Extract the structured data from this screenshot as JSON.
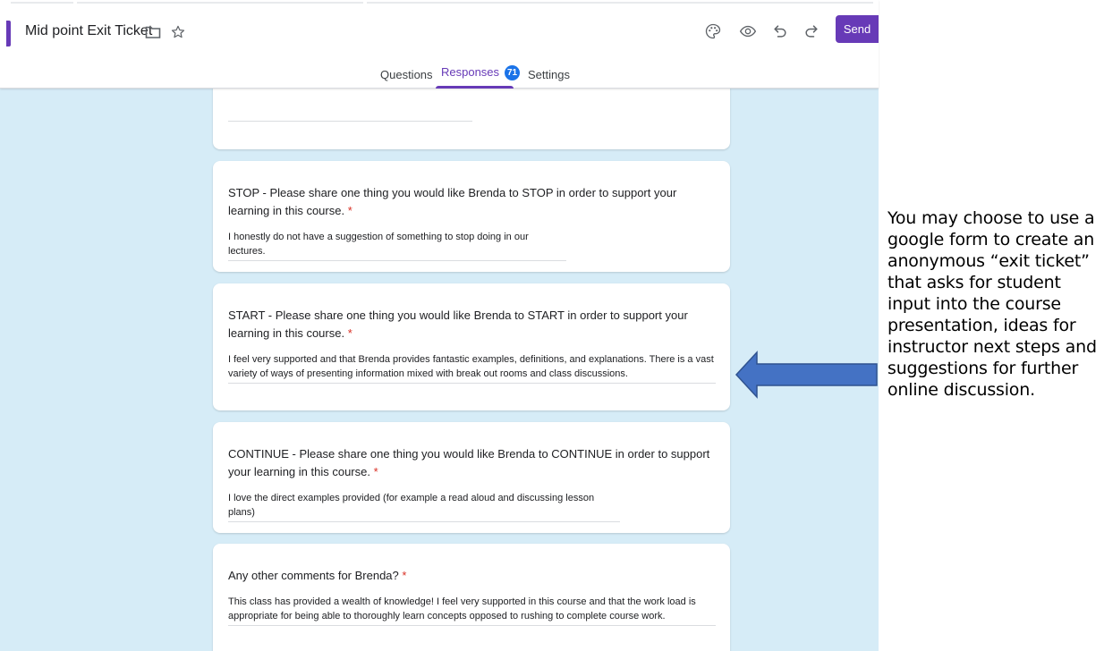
{
  "header": {
    "form_title": "Mid point Exit Ticket",
    "send_label": "Send",
    "icons": [
      "folder-icon",
      "star-icon",
      "palette-icon",
      "eye-icon",
      "undo-icon",
      "redo-icon"
    ]
  },
  "tabs": [
    {
      "label": "Questions"
    },
    {
      "label": "Responses",
      "count": "71",
      "active": true
    },
    {
      "label": "Settings"
    }
  ],
  "colors": {
    "accent": "#673ab7",
    "badge": "#1a73e8",
    "canvas": "#d6ecf7",
    "required": "#d93025",
    "arrow": "#4472c4"
  },
  "cards": [
    {
      "question": "STOP - Please share one thing you would like Brenda to STOP in order to support your learning in this course.",
      "required_mark": "*",
      "answer": "I honestly do not have a suggestion of something to stop doing in our lectures."
    },
    {
      "question": "START - Please share one thing you would like Brenda to START in order to support your learning in this course.",
      "required_mark": "*",
      "answer": "I feel very supported and that Brenda provides fantastic examples, definitions, and explanations. There is a vast variety of ways of presenting information mixed with break out rooms and class discussions."
    },
    {
      "question": "CONTINUE - Please share one thing you would like Brenda to CONTINUE in order to support your learning in this course.",
      "required_mark": "*",
      "answer": "I love the direct examples provided (for example a read aloud and discussing lesson plans)"
    },
    {
      "question": "Any other comments for Brenda?",
      "required_mark": "*",
      "answer": "This class has provided a wealth of knowledge! I feel very supported in this course and that the work load is appropriate for being able to thoroughly learn concepts opposed to rushing to complete course work."
    }
  ],
  "annotation": {
    "text": "You may choose to use a google form to create an anonymous “exit ticket” that asks for student input into the course presentation, ideas for instructor next steps and suggestions for further online discussion."
  }
}
